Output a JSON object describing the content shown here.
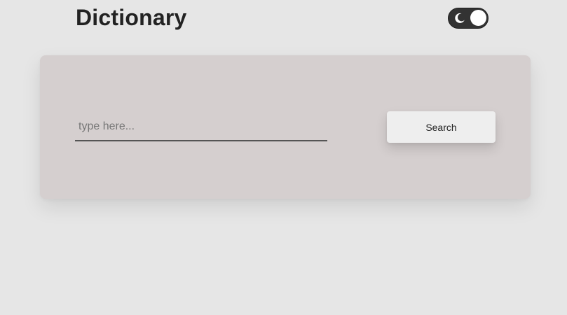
{
  "header": {
    "title": "Dictionary",
    "theme_toggle": {
      "state": "dark",
      "icon": "moon-icon"
    }
  },
  "search": {
    "placeholder": "type here...",
    "value": "",
    "button_label": "Search"
  },
  "colors": {
    "background": "#e6e6e6",
    "card": "#d5cfcf",
    "toggle_track": "#333333",
    "toggle_knob": "#ffffff",
    "button": "#eeeeee",
    "title_text": "#222222"
  }
}
